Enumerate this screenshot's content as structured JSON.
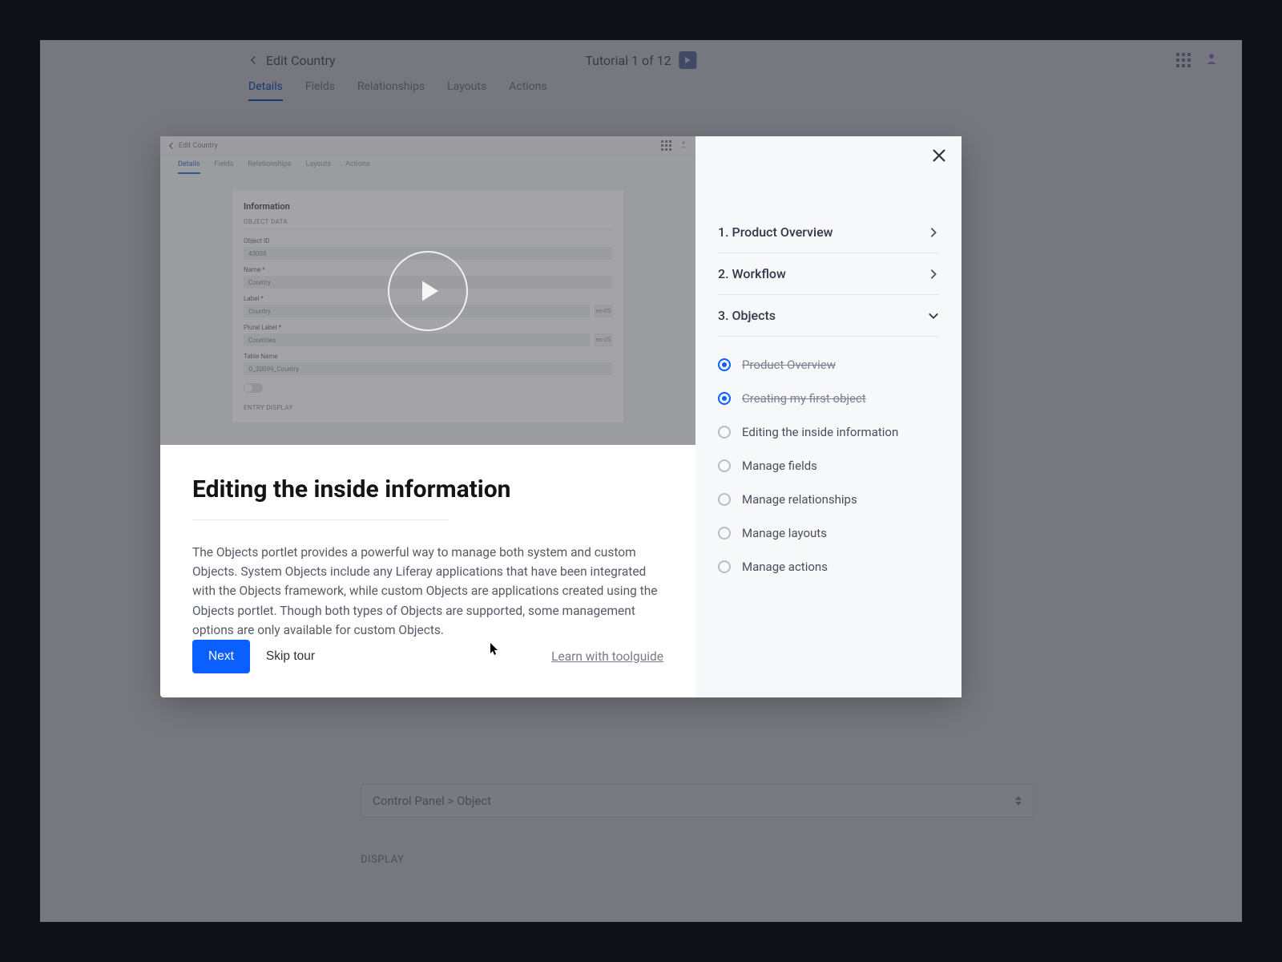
{
  "background": {
    "back_label": "Edit Country",
    "page_title": "Tutorial 1 of 12",
    "tabs": [
      "Details",
      "Fields",
      "Relationships",
      "Layouts",
      "Actions"
    ],
    "scope_value": "Control Panel > Object",
    "display_section": "DISPLAY"
  },
  "video_mock": {
    "back_label": "Edit Country",
    "tabs": [
      "Details",
      "Fields",
      "Relationships",
      "Layouts",
      "Actions"
    ],
    "panel_title": "Information",
    "panel_sub": "OBJECT DATA",
    "fields": {
      "object_id": {
        "label": "Object ID",
        "value": "43008"
      },
      "name": {
        "label": "Name *",
        "value": "Country"
      },
      "label": {
        "label": "Label *",
        "value": "Country",
        "flag": "en-US"
      },
      "plural": {
        "label": "Plural Label *",
        "value": "Countries",
        "flag": "en-US"
      },
      "table": {
        "label": "Table Name",
        "value": "O_20099_Country"
      }
    },
    "entry_display": "ENTRY DISPLAY"
  },
  "lesson": {
    "title": "Editing the inside information",
    "body": "The Objects portlet provides a powerful way to manage both system and custom Objects. System Objects include any Liferay applications that have been integrated with the Objects framework, while custom Objects are applications created using the Objects portlet. Though both types of Objects are supported, some management options are only available for custom Objects."
  },
  "footer": {
    "next": "Next",
    "skip": "Skip tour",
    "learn": "Learn with toolguide"
  },
  "sidebar": {
    "chapters": [
      {
        "label": "1. Product Overview"
      },
      {
        "label": "2. Workflow"
      },
      {
        "label": "3. Objects",
        "expanded": true
      }
    ],
    "lessons": [
      {
        "label": "Product Overview",
        "done": true
      },
      {
        "label": "Creating my first object",
        "done": true
      },
      {
        "label": "Editing the inside information",
        "done": false
      },
      {
        "label": "Manage fields",
        "done": false
      },
      {
        "label": "Manage relationships",
        "done": false
      },
      {
        "label": "Manage layouts",
        "done": false
      },
      {
        "label": "Manage actions",
        "done": false
      }
    ]
  }
}
